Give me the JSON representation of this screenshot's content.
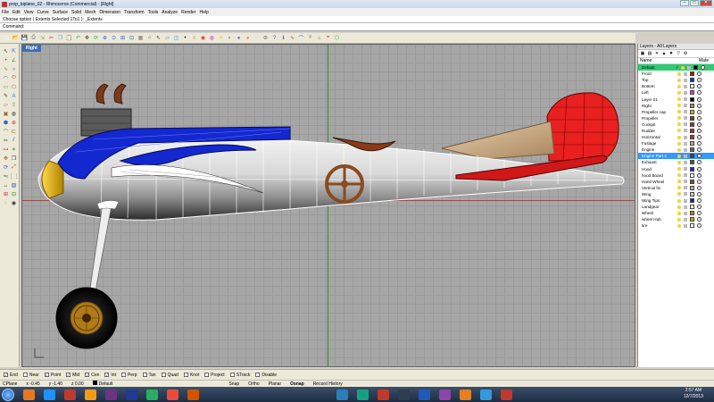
{
  "window": {
    "title": "prop_biplane_02 - Rhinoceros (Commercial) - [Right]",
    "controls": [
      "–",
      "□",
      "✕"
    ]
  },
  "menu": [
    "File",
    "Edit",
    "View",
    "Curve",
    "Surface",
    "Solid",
    "Mesh",
    "Dimension",
    "Transform",
    "Tools",
    "Analyze",
    "Render",
    "Help"
  ],
  "command": {
    "history": "Choose option ( Extents  Selected  1To1 ): _Extents",
    "label": "Command:"
  },
  "toolbar_icons": [
    "new-icon",
    "open-icon",
    "save-icon",
    "print-icon",
    "import-icon",
    "cut-icon",
    "copy-icon",
    "paste-icon",
    "undo-icon",
    "pan-icon",
    "rotate-icon",
    "zoom-window-icon",
    "zoom-dynamic-icon",
    "zoom-extents-icon",
    "zoom-selected-icon",
    "viewports-icon",
    "grid-icon",
    "select-icon",
    "plane-icon",
    "cplane-icon",
    "point-icon",
    "layer-icon",
    "render-icon",
    "material-icon",
    "light-icon",
    "display-mode-icon",
    "shaded-icon",
    "rendered-icon",
    "ghosted-icon",
    "options-icon",
    "help-icon",
    "properties-icon",
    "analyze-icon",
    "curvature-icon",
    "camera-icon",
    "draft-icon",
    "osnap-icon",
    "mesh-icon"
  ],
  "viewport": {
    "label": "Right"
  },
  "layers_panel": {
    "title": "Layers - All Layers",
    "col_name": "Name",
    "col_material": "Mate",
    "layers": [
      {
        "name": "Default",
        "color": "#000000",
        "state": "default",
        "check": "✓"
      },
      {
        "name": "Front",
        "color": "#cc0000"
      },
      {
        "name": "Top",
        "color": "#0033cc"
      },
      {
        "name": "Bottom",
        "color": "#ffffff"
      },
      {
        "name": "Left",
        "color": "#ff33cc"
      },
      {
        "name": "Layer 01",
        "color": "#000000"
      },
      {
        "name": "Right",
        "color": "#c08040"
      },
      {
        "name": "Propeller cap",
        "color": "#e0b000"
      },
      {
        "name": "Propeller",
        "color": "#7a3a1a"
      },
      {
        "name": "Cockpit",
        "color": "#884422"
      },
      {
        "name": "Rudder",
        "color": "#cc2222"
      },
      {
        "name": "Horizontal",
        "color": "#b03030"
      },
      {
        "name": "Fuslage",
        "color": "#c8a878"
      },
      {
        "name": "Engine",
        "color": "#666666"
      },
      {
        "name": "Engine Part 2",
        "color": "#444444",
        "state": "selected"
      },
      {
        "name": "Exhaust",
        "color": "#7a4a2a"
      },
      {
        "name": "Hood",
        "color": "#1a2acc"
      },
      {
        "name": "hood Board",
        "color": "#ffffff"
      },
      {
        "name": "Hand Wheel",
        "color": "#8a4a20"
      },
      {
        "name": "Vertical  fin",
        "color": "#d4a0a0"
      },
      {
        "name": "Wing",
        "color": "#cccccc"
      },
      {
        "name": "Wing Tips",
        "color": "#1020cc"
      },
      {
        "name": "Landgear",
        "color": "#ffffff"
      },
      {
        "name": "Wheel",
        "color": "#c08020"
      },
      {
        "name": "wheel Hub",
        "color": "#d0a000"
      },
      {
        "name": "tire",
        "color": "#ffffff"
      }
    ]
  },
  "osnap": [
    {
      "label": "End",
      "checked": true
    },
    {
      "label": "Near",
      "checked": false
    },
    {
      "label": "Point",
      "checked": true
    },
    {
      "label": "Mid",
      "checked": true
    },
    {
      "label": "Cen",
      "checked": true
    },
    {
      "label": "Int",
      "checked": true
    },
    {
      "label": "Perp",
      "checked": false
    },
    {
      "label": "Tan",
      "checked": false
    },
    {
      "label": "Quad",
      "checked": false
    },
    {
      "label": "Knot",
      "checked": false
    },
    {
      "label": "Project",
      "checked": false
    },
    {
      "label": "STrack",
      "checked": false
    },
    {
      "label": "Disable",
      "checked": false
    }
  ],
  "status": {
    "cplane": "CPlane",
    "x": "x -0.45",
    "y": "y -1.40",
    "z": "z 0.00",
    "layer": "Default",
    "toggles": [
      "Snap",
      "Ortho",
      "Planar",
      "Osnap",
      "Record History"
    ]
  },
  "taskbar": {
    "time": "2:57 AM",
    "date": "12/7/2013",
    "apps": [
      "#e87722",
      "#1e90ff",
      "#c0392b",
      "#f39c12",
      "#6c3483",
      "#1f3a93",
      "#27ae60",
      "#e74c3c",
      "#d35400",
      "#2980b9",
      "#16a085",
      "#c0392b",
      "#2c3e50",
      "#1e5bb8",
      "#8e44ad",
      "#e67e22",
      "#3498db",
      "#c0392b"
    ]
  }
}
